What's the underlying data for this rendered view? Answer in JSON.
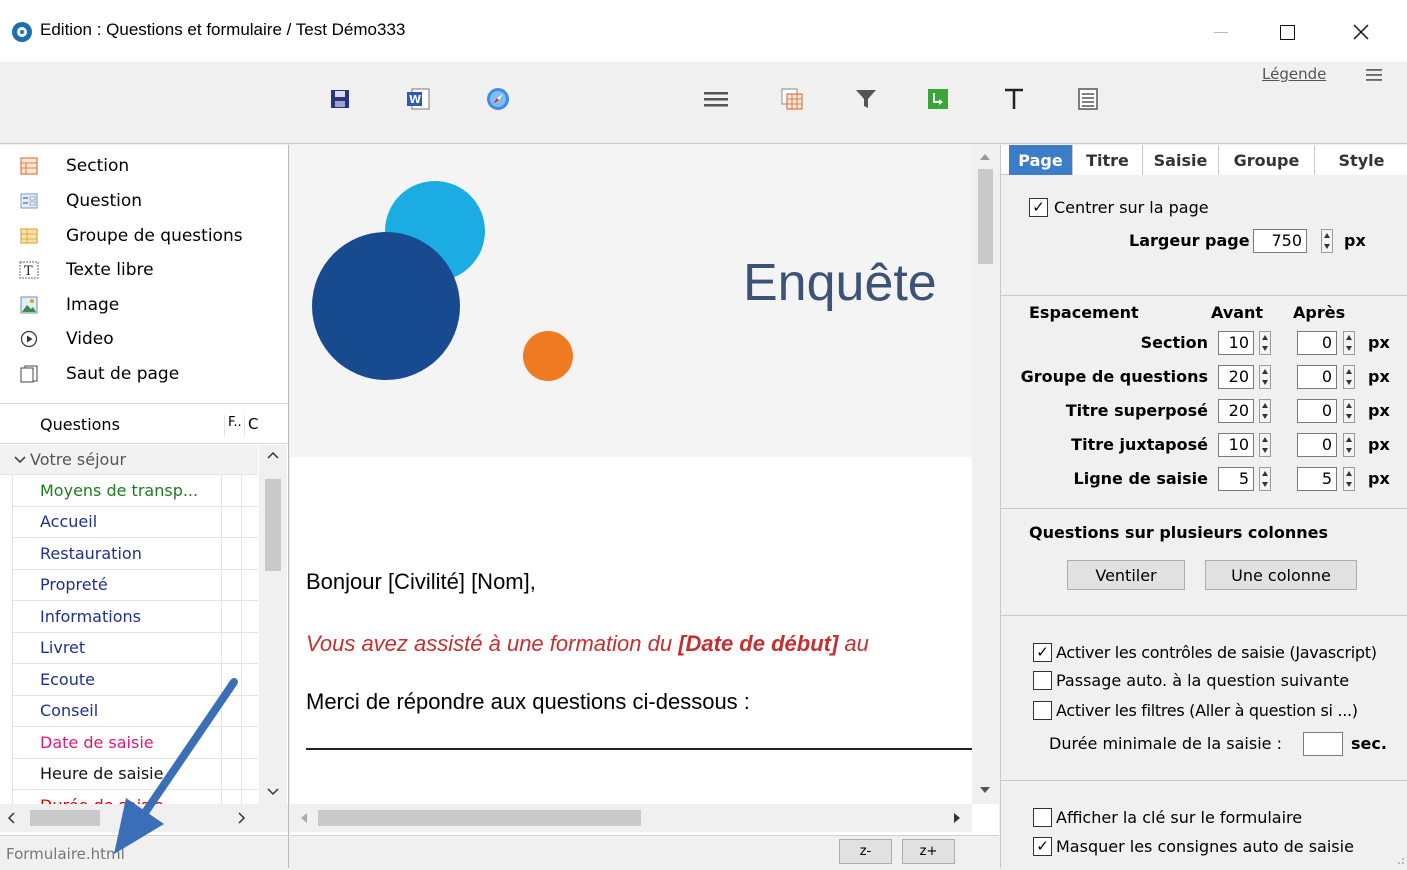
{
  "window": {
    "title": "Edition : Questions et formulaire / Test Démo333"
  },
  "toolbar": {
    "legend_label": "Légende"
  },
  "insert_items": [
    {
      "label": "Section",
      "icon": "section-icon"
    },
    {
      "label": "Question",
      "icon": "question-icon"
    },
    {
      "label": "Groupe de questions",
      "icon": "question-group-icon"
    },
    {
      "label": "Texte libre",
      "icon": "free-text-icon"
    },
    {
      "label": "Image",
      "icon": "image-icon"
    },
    {
      "label": "Video",
      "icon": "video-icon"
    },
    {
      "label": "Saut de page",
      "icon": "page-break-icon"
    }
  ],
  "questions": {
    "header": "Questions",
    "col2": "F..",
    "col3": "C",
    "group": "Votre séjour",
    "rows": [
      {
        "label": "Moyens de transp...",
        "color": "#1e7b1e"
      },
      {
        "label": "Accueil",
        "color": "#1f2f8f"
      },
      {
        "label": "Restauration",
        "color": "#1f2f8f"
      },
      {
        "label": "Propreté",
        "color": "#1f2f8f"
      },
      {
        "label": "Informations",
        "color": "#1f2f8f"
      },
      {
        "label": "Livret",
        "color": "#1f2f8f"
      },
      {
        "label": "Ecoute",
        "color": "#1f2f8f"
      },
      {
        "label": "Conseil",
        "color": "#1f2f8f"
      },
      {
        "label": "Date de saisie",
        "color": "#e0177a"
      },
      {
        "label": "Heure de saisie",
        "color": "#111111"
      },
      {
        "label": "Durée de saisie",
        "color": "#e00000"
      }
    ]
  },
  "status": {
    "filename": "Formulaire.html"
  },
  "preview": {
    "title": "Enquête",
    "greeting": "Bonjour [Civilité] [Nom],",
    "italic_line_start": "Vous avez assisté à une formation du ",
    "italic_line_bold": "[Date de début]",
    "italic_line_end": " au",
    "instruction": "Merci de répondre aux questions ci-dessous :",
    "zoom_out": "z-",
    "zoom_in": "z+"
  },
  "tabs": [
    "Page",
    "Titre",
    "Saisie",
    "Groupe",
    "Style"
  ],
  "page_settings": {
    "center_label": "Centrer sur la page",
    "center_checked": true,
    "width_label": "Largeur page",
    "width_value": "750",
    "unit": "px"
  },
  "spacing": {
    "title": "Espacement",
    "before_label": "Avant",
    "after_label": "Après",
    "rows": [
      {
        "label": "Section",
        "before": "10",
        "after": "0"
      },
      {
        "label": "Groupe de questions",
        "before": "20",
        "after": "0"
      },
      {
        "label": "Titre superposé",
        "before": "20",
        "after": "0"
      },
      {
        "label": "Titre juxtaposé",
        "before": "10",
        "after": "0"
      },
      {
        "label": "Ligne de saisie",
        "before": "5",
        "after": "5"
      }
    ],
    "unit": "px"
  },
  "columns": {
    "title": "Questions sur plusieurs colonnes",
    "ventiler": "Ventiler",
    "une_colonne": "Une colonne"
  },
  "options": [
    {
      "label": "Activer les contrôles de saisie (Javascript)",
      "checked": true
    },
    {
      "label": "Passage auto. à la question suivante",
      "checked": false
    },
    {
      "label": "Activer les filtres (Aller à question si ...)",
      "checked": false
    }
  ],
  "min_duration": {
    "label": "Durée minimale de la saisie :",
    "value": "",
    "unit": "sec."
  },
  "bottom_options": [
    {
      "label": "Afficher la clé sur le formulaire",
      "checked": false
    },
    {
      "label": "Masquer les consignes auto de saisie",
      "checked": true
    }
  ],
  "colors": {
    "accent_tab": "#3d7cc9",
    "circle_light": "#1aace3",
    "circle_dark": "#174a8f",
    "circle_orange": "#ee7a22",
    "arrow": "#3a6fb8"
  }
}
